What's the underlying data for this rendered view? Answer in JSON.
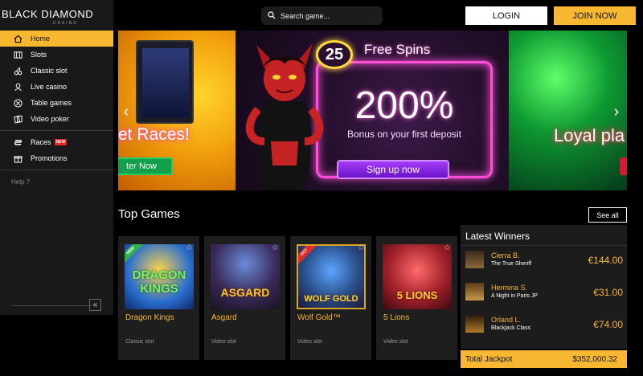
{
  "brand": {
    "name": "BLACK DIAMOND",
    "sub": "CASINO"
  },
  "sidebar": {
    "items": [
      {
        "label": "Home",
        "icon": "home-icon",
        "active": true
      },
      {
        "label": "Slots",
        "icon": "slots-icon"
      },
      {
        "label": "Classic slot",
        "icon": "cherry-icon"
      },
      {
        "label": "Live casino",
        "icon": "dealer-icon"
      },
      {
        "label": "Table games",
        "icon": "chip-icon"
      },
      {
        "label": "Video poker",
        "icon": "cards-icon"
      },
      {
        "label": "Races",
        "icon": "races-icon",
        "badge": "NEW"
      },
      {
        "label": "Promotions",
        "icon": "gift-icon"
      }
    ],
    "help": "Help ?",
    "collapse": "«"
  },
  "header": {
    "search_placeholder": "Search game...",
    "login": "LOGIN",
    "join": "JOIN NOW"
  },
  "carousel": {
    "slide1": {
      "text": "et Races!",
      "cta": "ter Now"
    },
    "slide2": {
      "spins_number": "25",
      "spins_text": "Free Spins",
      "percent": "200%",
      "subtitle": "Bonus on your first deposit",
      "cta": "Sign up now"
    },
    "slide3": {
      "text": "Loyal pla"
    },
    "prev": "‹",
    "next": "›"
  },
  "top_games": {
    "title": "Top Games",
    "see_all": "See all",
    "games": [
      {
        "name": "Dragon Kings",
        "category": "Classic slot",
        "ribbon": "NEW",
        "thumb_text": "DRAGON KINGS"
      },
      {
        "name": "Asgard",
        "category": "Video slot",
        "ribbon": "",
        "thumb_text": "ASGARD"
      },
      {
        "name": "Wolf Gold™",
        "category": "Video slot",
        "ribbon": "HOT",
        "thumb_text": "WOLF GOLD"
      },
      {
        "name": "5 Lions",
        "category": "Video slot",
        "ribbon": "",
        "thumb_text": "5 LIONS"
      }
    ]
  },
  "winners": {
    "title": "Latest Winners",
    "rows": [
      {
        "name": "Cierra B.",
        "game": "The True Sheriff",
        "amount": "€144.00"
      },
      {
        "name": "Hermina S.",
        "game": "A Night in Paris JP",
        "amount": "€31.00"
      },
      {
        "name": "Orland L.",
        "game": "Blackjack Class",
        "amount": "€74.00"
      }
    ],
    "jackpot_label": "Total Jackpot",
    "jackpot_value": "$352,000.32"
  },
  "colors": {
    "accent": "#f7b731",
    "sidebar_bg": "#191919",
    "card_bg": "#1e1e1e"
  }
}
